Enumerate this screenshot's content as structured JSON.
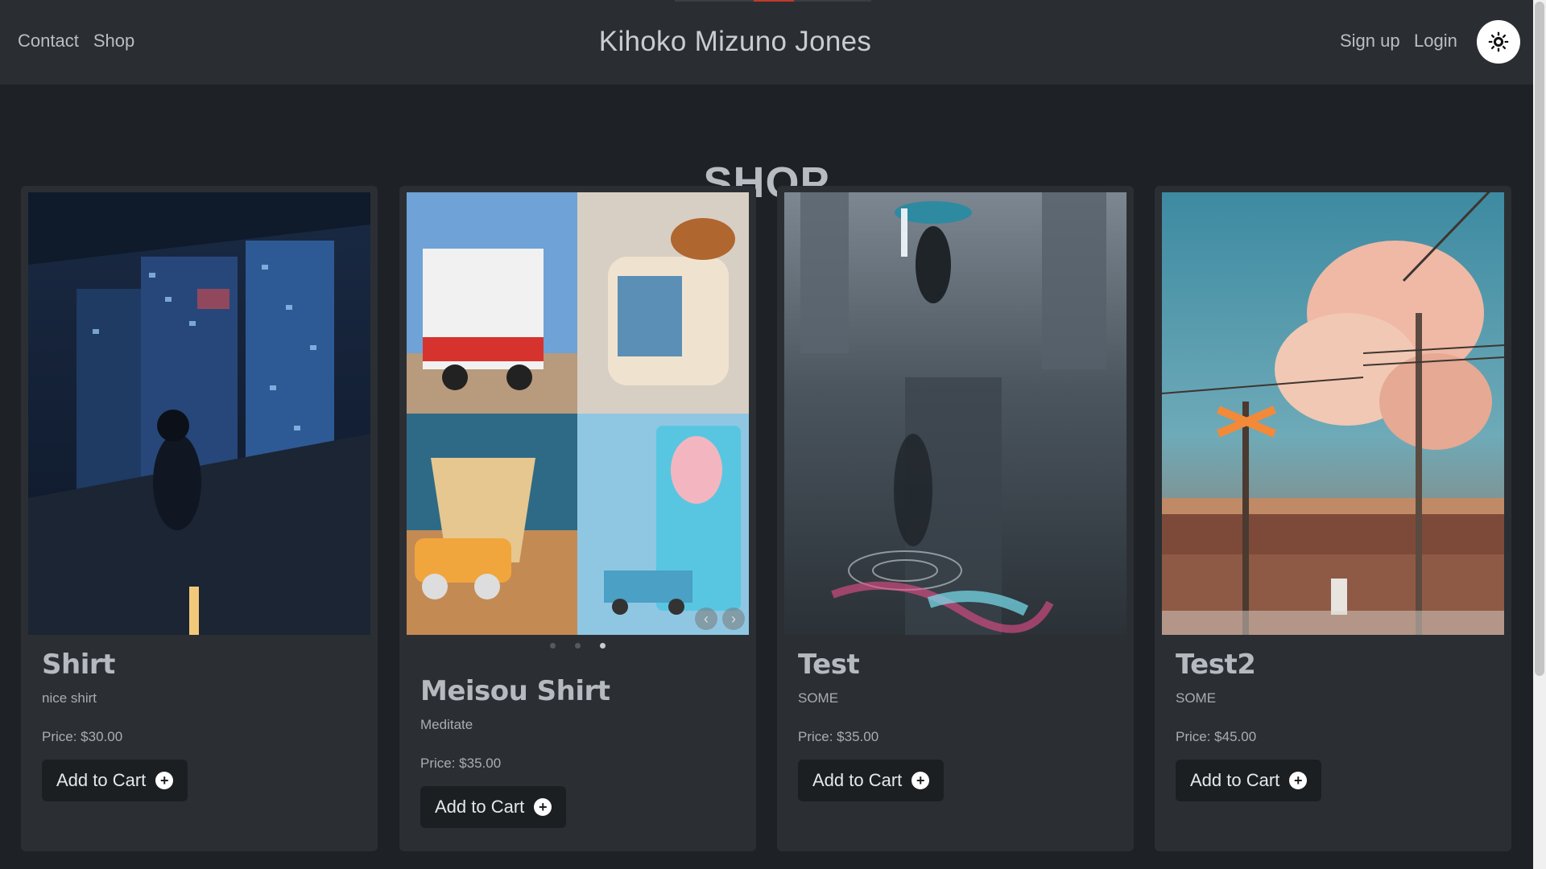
{
  "nav": {
    "links": [
      "Contact",
      "Shop"
    ],
    "brand": "Kihoko Mizuno Jones",
    "signup": "Sign up",
    "login": "Login",
    "theme_icon": "sun-gear-icon"
  },
  "heading": "SHOP",
  "products": [
    {
      "title": "Shirt",
      "description": "nice shirt",
      "price": "Price: $30.00",
      "button": "Add to Cart"
    },
    {
      "title": "Meisou Shirt",
      "description": "Meditate",
      "price": "Price: $35.00",
      "button": "Add to Cart"
    },
    {
      "title": "Test",
      "description": "SOME",
      "price": "Price: $35.00",
      "button": "Add to Cart"
    },
    {
      "title": "Test2",
      "description": "SOME",
      "price": "Price: $45.00",
      "button": "Add to Cart"
    }
  ],
  "carousel": {
    "dots": 3,
    "active_index": 2
  },
  "colors": {
    "background": "#1e2125",
    "navbar": "#2a2e33",
    "card": "#2b2f34",
    "button": "#1c1f22"
  }
}
